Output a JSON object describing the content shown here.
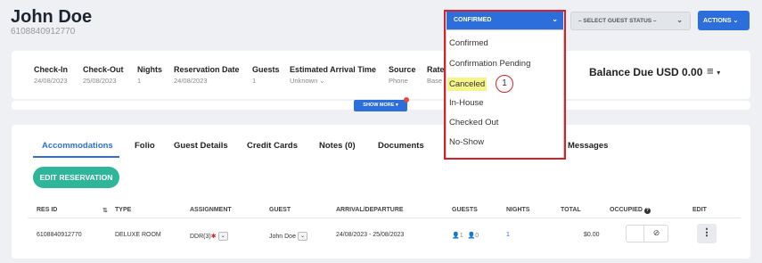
{
  "guest": {
    "name": "John Doe",
    "reservation_number": "6108840912770"
  },
  "header": {
    "status_selected": "CONFIRMED",
    "guest_status_placeholder": "– SELECT GUEST STATUS –",
    "actions_label": "ACTIONS"
  },
  "summary": {
    "checkin": {
      "label": "Check-In",
      "value": "24/08/2023"
    },
    "checkout": {
      "label": "Check-Out",
      "value": "25/08/2023"
    },
    "nights": {
      "label": "Nights",
      "value": "1"
    },
    "reservation_date": {
      "label": "Reservation Date",
      "value": "24/08/2023"
    },
    "guests": {
      "label": "Guests",
      "value": "1"
    },
    "arrival_time": {
      "label": "Estimated Arrival Time",
      "value": "Unknown"
    },
    "source": {
      "label": "Source",
      "value": "Phone"
    },
    "rate": {
      "label": "Rate",
      "value": "Base"
    },
    "balance": "Balance Due USD 0.00"
  },
  "show_more_label": "SHOW MORE",
  "tabs": [
    "Accommodations",
    "Folio",
    "Guest Details",
    "Credit Cards",
    "Notes (0)",
    "Documents",
    "Messages"
  ],
  "edit_reservation_label": "EDIT RESERVATION",
  "table": {
    "headers": [
      "RES ID",
      "TYPE",
      "ASSIGNMENT",
      "GUEST",
      "ARRIVAL/DEPARTURE",
      "GUESTS",
      "NIGHTS",
      "TOTAL",
      "OCCUPIED",
      "EDIT"
    ],
    "row": {
      "res_id": "6108840912770",
      "type": "DELUXE ROOM",
      "assignment": "DDR(3)",
      "guest": "John Doe",
      "arrival_departure": "24/08/2023 - 25/08/2023",
      "adults": "1",
      "children": "0",
      "nights": "1",
      "total": "$0.00"
    }
  },
  "status_options": [
    "Confirmed",
    "Confirmation Pending",
    "Canceled",
    "In-House",
    "Checked Out",
    "No-Show"
  ],
  "callout_number": "1",
  "colors": {
    "primary": "#2c6fdc",
    "accent_green": "#2fb59a",
    "highlight": "#f6f58a",
    "annotation_red": "#d8202a"
  }
}
